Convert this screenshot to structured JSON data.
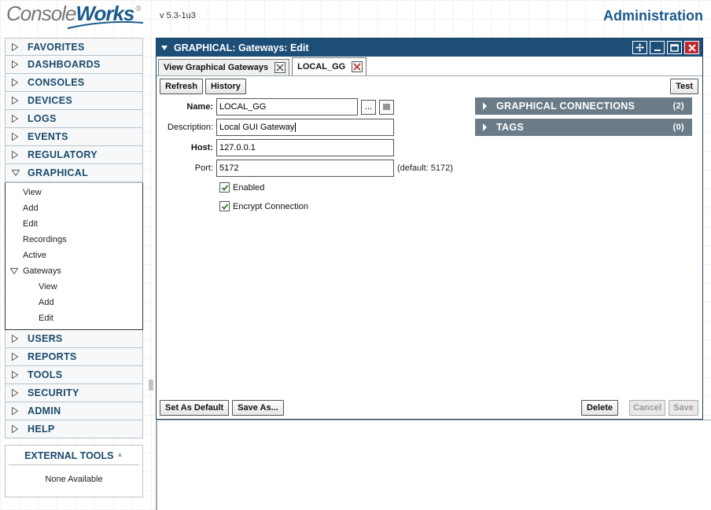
{
  "header": {
    "logo_part1": "Console",
    "logo_part2": "Works",
    "logo_reg": "®",
    "version": "v 5.3-1u3",
    "section_title": "Administration"
  },
  "sidebar": {
    "items_top": [
      {
        "label": "FAVORITES"
      },
      {
        "label": "DASHBOARDS"
      },
      {
        "label": "CONSOLES"
      },
      {
        "label": "DEVICES"
      },
      {
        "label": "LOGS"
      },
      {
        "label": "EVENTS"
      },
      {
        "label": "REGULATORY"
      }
    ],
    "graphical": {
      "label": "GRAPHICAL",
      "children": [
        "View",
        "Add",
        "Edit",
        "Recordings",
        "Active"
      ],
      "gateways": {
        "label": "Gateways",
        "children": [
          "View",
          "Add",
          "Edit"
        ]
      }
    },
    "items_bottom": [
      {
        "label": "USERS"
      },
      {
        "label": "REPORTS"
      },
      {
        "label": "TOOLS"
      },
      {
        "label": "SECURITY"
      },
      {
        "label": "ADMIN"
      },
      {
        "label": "HELP"
      }
    ],
    "external_tools": {
      "title": "EXTERNAL TOOLS",
      "body": "None Available"
    }
  },
  "panel": {
    "title": "GRAPHICAL: Gateways: Edit",
    "tabs": [
      {
        "label": "View Graphical Gateways",
        "active": false
      },
      {
        "label": "LOCAL_GG",
        "active": true
      }
    ],
    "toolbar": {
      "refresh": "Refresh",
      "history": "History",
      "test": "Test"
    },
    "form": {
      "name_label": "Name:",
      "name_value": "LOCAL_GG",
      "name_more": "...",
      "description_label": "Description:",
      "description_value": "Local GUI Gateway",
      "host_label": "Host:",
      "host_value": "127.0.0.1",
      "port_label": "Port:",
      "port_value": "5172",
      "port_hint": "(default: 5172)",
      "enabled_label": "Enabled",
      "enabled_checked": true,
      "encrypt_label": "Encrypt Connection",
      "encrypt_checked": true
    },
    "accordions": [
      {
        "label": "GRAPHICAL CONNECTIONS",
        "count": "(2)"
      },
      {
        "label": "TAGS",
        "count": "(0)"
      }
    ],
    "footer": {
      "set_default": "Set As Default",
      "save_as": "Save As...",
      "delete": "Delete",
      "cancel": "Cancel",
      "save": "Save"
    }
  },
  "colors": {
    "brand": "#1a5a8c",
    "titlebar": "#1d4e78",
    "close": "#c0272d",
    "accordion": "#6b7c88"
  }
}
